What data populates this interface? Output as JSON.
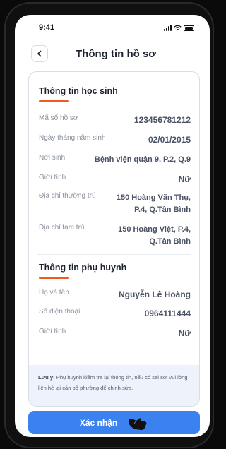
{
  "status_bar": {
    "time": "9:41"
  },
  "header": {
    "title": "Thông tin hồ sơ"
  },
  "student": {
    "title": "Thông tin học sinh",
    "rows": [
      {
        "label": "Mã số hồ sơ",
        "value": "123456781212"
      },
      {
        "label": "Ngày tháng năm sinh",
        "value": "02/01/2015"
      },
      {
        "label": "Nơi sinh",
        "value": "Bệnh viện quận 9, P.2, Q.9"
      },
      {
        "label": "Giới tính",
        "value": "Nữ"
      },
      {
        "label": "Địa chỉ thường trú",
        "value_line1": "150 Hoàng Văn Thụ,",
        "value_line2": "P.4, Q.Tân Bình"
      },
      {
        "label": "Địa chỉ tạm trú",
        "value_line1": "150 Hoàng Việt, P.4,",
        "value_line2": "Q.Tân Bình"
      }
    ]
  },
  "parent": {
    "title": "Thông tin phụ huynh",
    "rows": [
      {
        "label": "Họ và tên",
        "value": "Nguyễn Lê Hoàng"
      },
      {
        "label": "Số điện thoại",
        "value": "0964111444"
      },
      {
        "label": "Giới tính",
        "value": "Nữ"
      }
    ]
  },
  "note": {
    "prefix": "Lưu ý:",
    "text": " Phụ huynh kiểm tra lại thông tin, nếu có sai sót vui lòng liên hệ lại cán bộ phường để chỉnh sửa."
  },
  "confirm_button": {
    "label": "Xác nhận"
  },
  "colors": {
    "accent": "#3b82f0",
    "underline": "#ee5a24",
    "note_bg": "#eef3fb"
  }
}
